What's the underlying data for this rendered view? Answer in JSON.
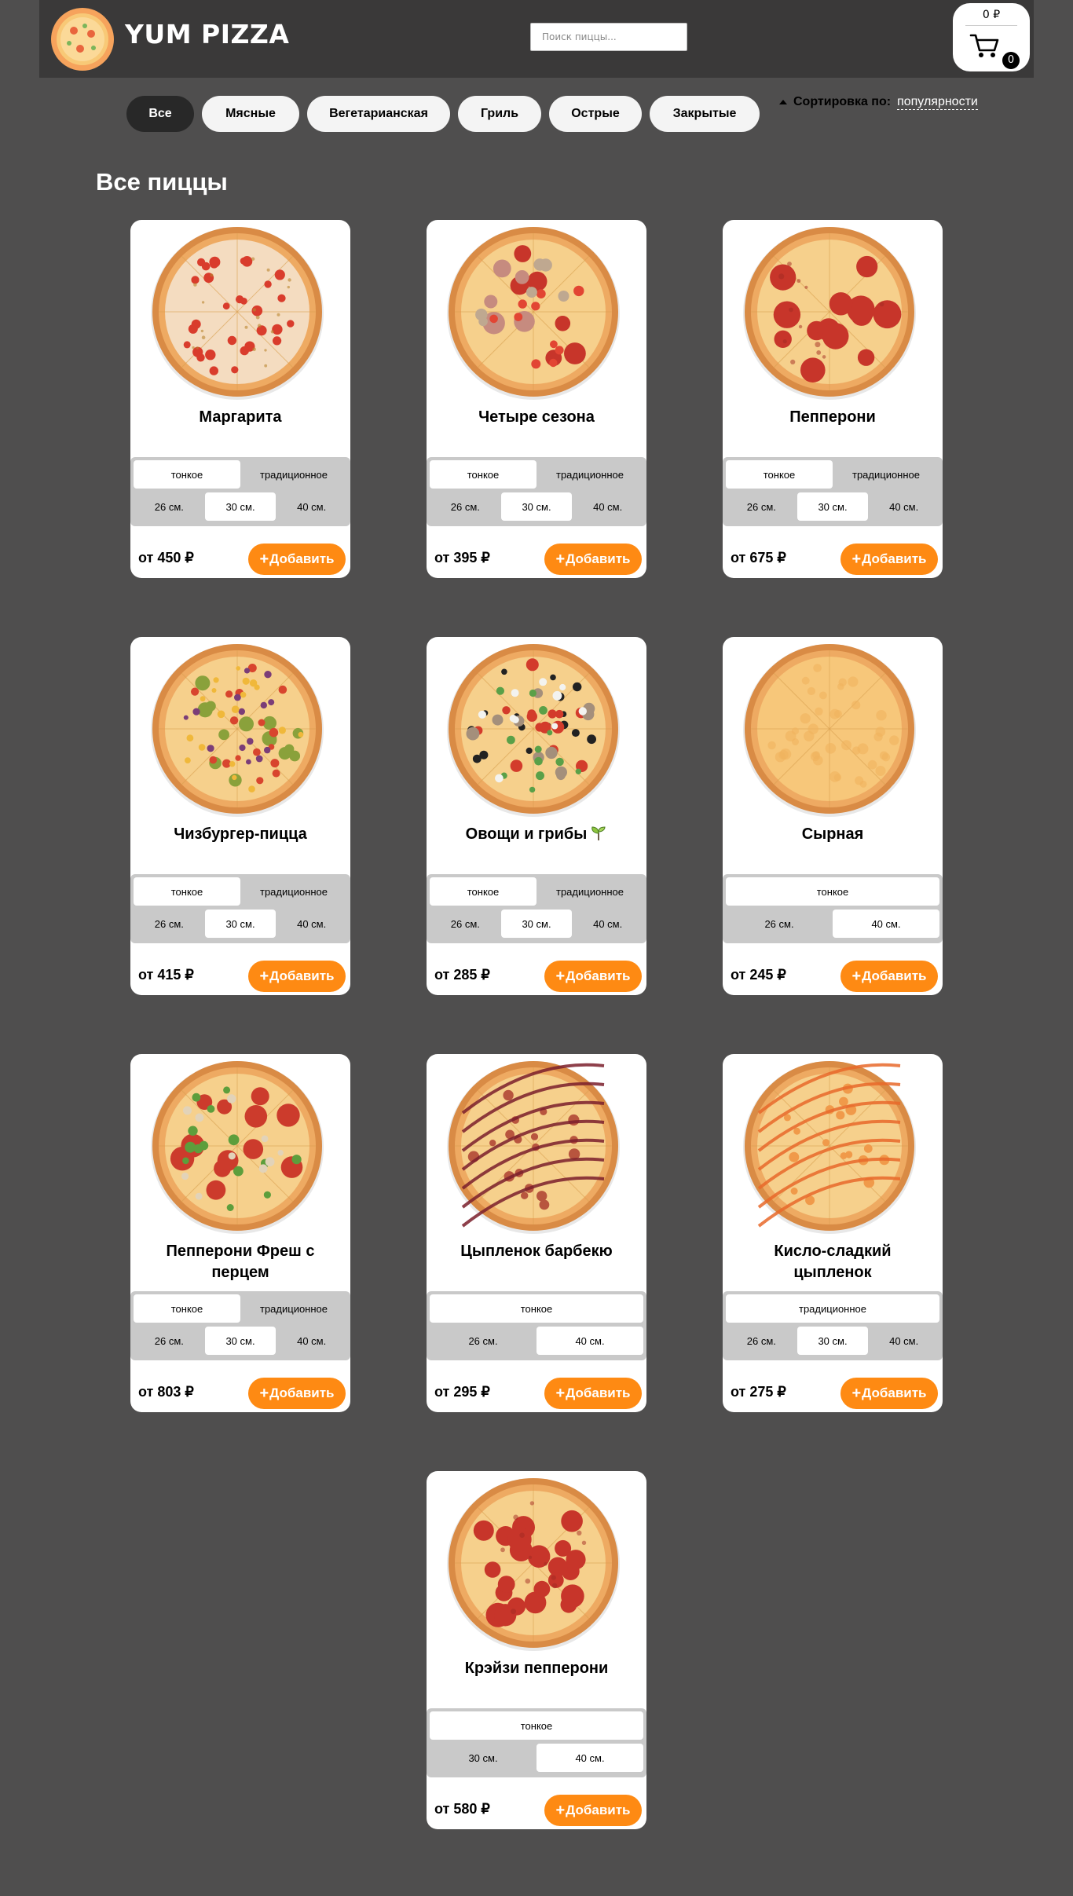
{
  "header": {
    "brand": "YUM PIZZA",
    "search_placeholder": "Поиск пиццы...",
    "cart": {
      "total": "0 ₽",
      "count": "0"
    }
  },
  "categories": [
    {
      "label": "Все",
      "active": true
    },
    {
      "label": "Мясные",
      "active": false
    },
    {
      "label": "Вегетарианская",
      "active": false
    },
    {
      "label": "Гриль",
      "active": false
    },
    {
      "label": "Острые",
      "active": false
    },
    {
      "label": "Закрытые",
      "active": false
    }
  ],
  "sort": {
    "label": "Сортировка по:",
    "value": "популярности"
  },
  "page_title": "Все пиццы",
  "add_label": "Добавить",
  "colors": {
    "accent": "#fe8a13",
    "background": "#4f4e4e",
    "header": "#3a3939"
  },
  "pizzas": [
    {
      "name": "Маргарита",
      "style": "margherita",
      "types": [
        "тонкое",
        "традиционное"
      ],
      "active_type": 0,
      "sizes": [
        "26 см.",
        "30 см.",
        "40 см."
      ],
      "active_size": 1,
      "price": "от 450 ₽"
    },
    {
      "name": "Четыре сезона",
      "style": "seasons",
      "types": [
        "тонкое",
        "традиционное"
      ],
      "active_type": 0,
      "sizes": [
        "26 см.",
        "30 см.",
        "40 см."
      ],
      "active_size": 1,
      "price": "от 395 ₽"
    },
    {
      "name": "Пепперони",
      "style": "pepperoni",
      "types": [
        "тонкое",
        "традиционное"
      ],
      "active_type": 0,
      "sizes": [
        "26 см.",
        "30 см.",
        "40 см."
      ],
      "active_size": 1,
      "price": "от 675 ₽"
    },
    {
      "name": "Чизбургер-пицца",
      "style": "cheeseburger",
      "types": [
        "тонкое",
        "традиционное"
      ],
      "active_type": 0,
      "sizes": [
        "26 см.",
        "30 см.",
        "40 см."
      ],
      "active_size": 1,
      "price": "от 415 ₽"
    },
    {
      "name": "Овощи и грибы",
      "style": "veggie",
      "vegetarian_icon": "leaf-icon",
      "types": [
        "тонкое",
        "традиционное"
      ],
      "active_type": 0,
      "sizes": [
        "26 см.",
        "30 см.",
        "40 см."
      ],
      "active_size": 1,
      "price": "от 285 ₽"
    },
    {
      "name": "Сырная",
      "style": "cheese",
      "types": [
        "тонкое"
      ],
      "active_type": 0,
      "sizes": [
        "26 см.",
        "40 см."
      ],
      "active_size": 1,
      "price": "от 245 ₽"
    },
    {
      "name": "Пепперони Фреш с перцем",
      "style": "pepperoni-fresh",
      "types": [
        "тонкое",
        "традиционное"
      ],
      "active_type": 0,
      "sizes": [
        "26 см.",
        "30 см.",
        "40 см."
      ],
      "active_size": 1,
      "price": "от 803 ₽"
    },
    {
      "name": "Цыпленок барбекю",
      "style": "bbq",
      "types": [
        "тонкое"
      ],
      "active_type": 0,
      "sizes": [
        "26 см.",
        "40 см."
      ],
      "active_size": 1,
      "price": "от 295 ₽"
    },
    {
      "name": "Кисло-сладкий цыпленок",
      "style": "sweet-sour",
      "types": [
        "традиционное"
      ],
      "active_type": 0,
      "sizes": [
        "26 см.",
        "30 см.",
        "40 см."
      ],
      "active_size": 1,
      "price": "от 275 ₽"
    },
    {
      "name": "Крэйзи пепперони",
      "style": "crazy-pepperoni",
      "types": [
        "тонкое"
      ],
      "active_type": 0,
      "sizes": [
        "30 см.",
        "40 см."
      ],
      "active_size": 1,
      "price": "от 580 ₽"
    }
  ]
}
